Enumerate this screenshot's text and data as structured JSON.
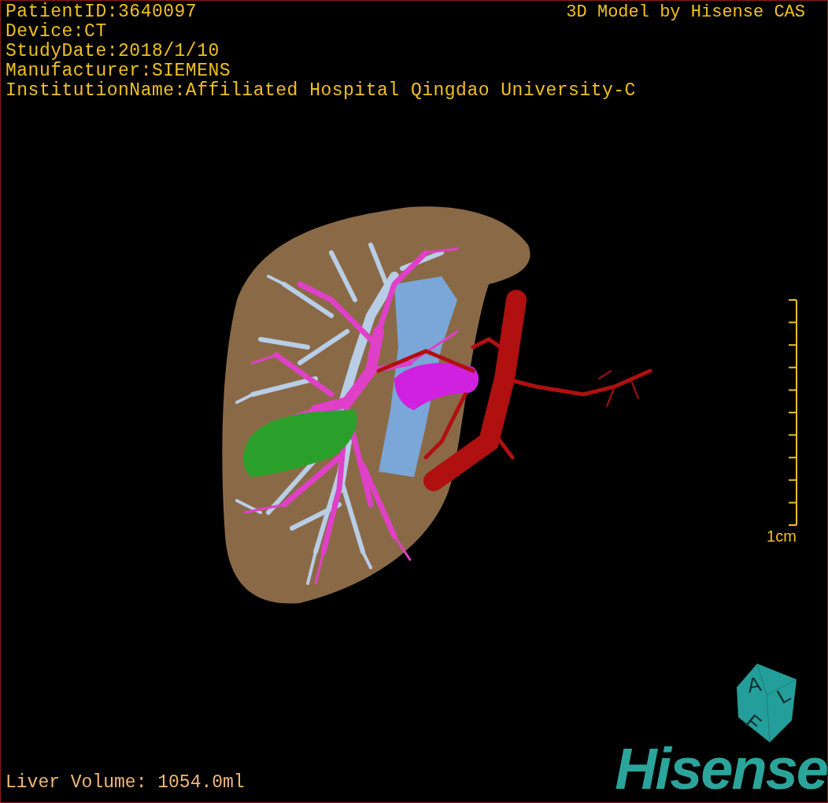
{
  "viewport": {
    "patient_info": [
      "PatientID:3640097",
      "Device:CT",
      "StudyDate:2018/1/10",
      "Manufacturer:SIEMENS",
      "InstitutionName:Affiliated Hospital Qingdao University-C"
    ],
    "brand_caption": "3D Model by Hisense CAS",
    "measurement": "Liver Volume: 1054.0ml"
  },
  "scale_bar": {
    "label": "1cm"
  },
  "orientation_cube": {
    "faces": [
      "A",
      "L",
      "F"
    ]
  },
  "logo": {
    "text": "Hisense"
  }
}
